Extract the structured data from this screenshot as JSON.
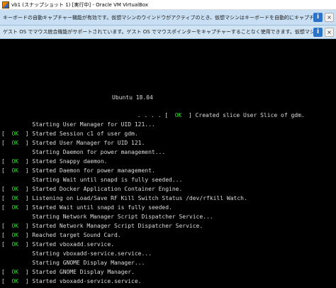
{
  "window": {
    "title": "vb1 (スナップショット 1) [実行中] - Oracle VM VirtualBox",
    "icon": "virtualbox-icon"
  },
  "notifications": [
    {
      "text": "キーボードの自動キャプチャー機能が有効です。仮想マシンのウインドウがアクティブのとき、仮想マシンはキーボードを自動的にキャプチャーします。キーボードがキャプチャーされると...",
      "info_icon": "i",
      "close_icon": "×"
    },
    {
      "text": "ゲスト OS でマウス統合機能がサポートされています。ゲスト OS でマウスポインターをキャプチャーすることなく使用できます。仮想マシンの画面上にマウスポインターがあるとき、すべてのマウス...",
      "info_icon": "i",
      "close_icon": "×"
    }
  ],
  "console": {
    "boot_header": "Ubuntu 18.04",
    "lines": [
      {
        "pre": "       . . . . [",
        "ok": "  OK  ",
        "post": "] Created slice User Slice of gdm."
      },
      {
        "pre": "         Starting User Manager for UID 121...",
        "ok": "",
        "post": ""
      },
      {
        "pre": "[",
        "ok": "  OK  ",
        "post": "] Started Session c1 of user gdm."
      },
      {
        "pre": "[",
        "ok": "  OK  ",
        "post": "] Started User Manager for UID 121."
      },
      {
        "pre": "         Starting Daemon for power management...",
        "ok": "",
        "post": ""
      },
      {
        "pre": "[",
        "ok": "  OK  ",
        "post": "] Started Snappy daemon."
      },
      {
        "pre": "[",
        "ok": "  OK  ",
        "post": "] Started Daemon for power management."
      },
      {
        "pre": "         Starting Wait until snapd is fully seeded...",
        "ok": "",
        "post": ""
      },
      {
        "pre": "[",
        "ok": "  OK  ",
        "post": "] Started Docker Application Container Engine."
      },
      {
        "pre": "[",
        "ok": "  OK  ",
        "post": "] Listening on Load/Save RF Kill Switch Status /dev/rfkill Watch."
      },
      {
        "pre": "[",
        "ok": "  OK  ",
        "post": "] Started Wait until snapd is fully seeded."
      },
      {
        "pre": "         Starting Network Manager Script Dispatcher Service...",
        "ok": "",
        "post": ""
      },
      {
        "pre": "[",
        "ok": "  OK  ",
        "post": "] Started Network Manager Script Dispatcher Service."
      },
      {
        "pre": "[",
        "ok": "  OK  ",
        "post": "] Reached target Sound Card."
      },
      {
        "pre": "[",
        "ok": "  OK  ",
        "post": "] Started vboxadd.service."
      },
      {
        "pre": "         Starting vboxadd-service.service...",
        "ok": "",
        "post": ""
      },
      {
        "pre": "         Starting GNOME Display Manager...",
        "ok": "",
        "post": ""
      },
      {
        "pre": "[",
        "ok": "  OK  ",
        "post": "] Started GNOME Display Manager."
      },
      {
        "pre": "[",
        "ok": "  OK  ",
        "post": "] Started vboxadd-service.service."
      }
    ]
  }
}
